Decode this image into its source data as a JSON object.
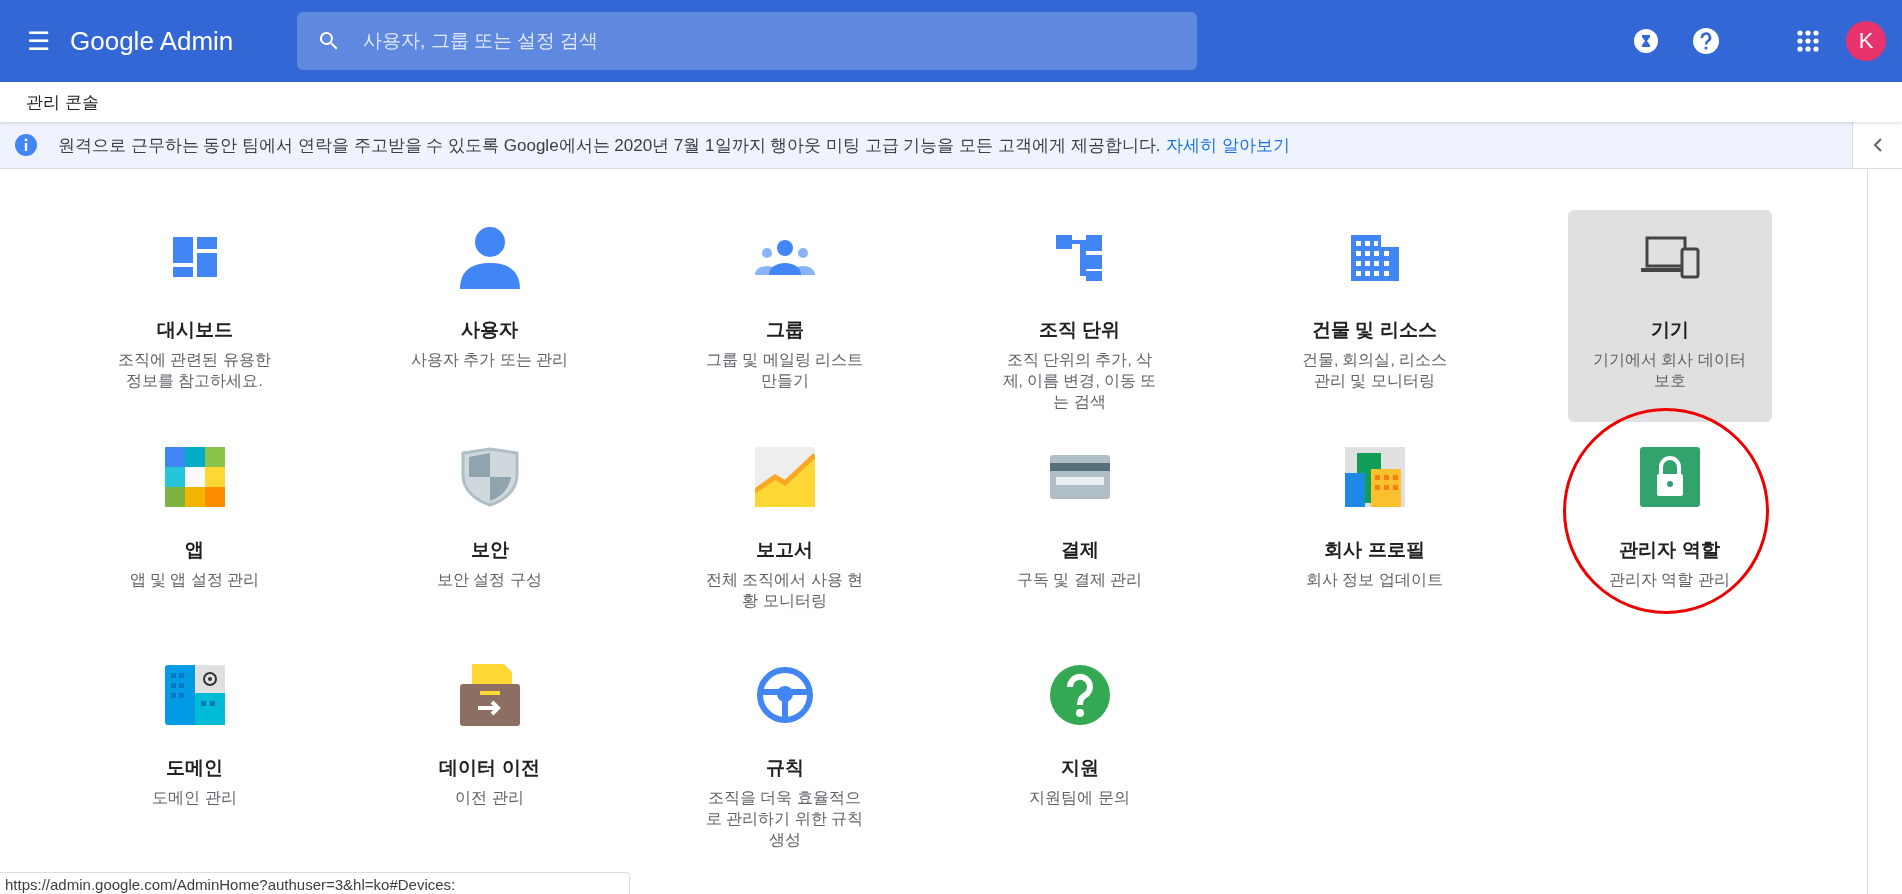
{
  "header": {
    "menu": "☰",
    "logo": "Google Admin",
    "search": {
      "placeholder": "사용자, 그룹 또는 설정 검색"
    },
    "avatar": "K"
  },
  "breadcrumb": "관리 콘솔",
  "banner": {
    "text": "원격으로 근무하는 동안 팀에서 연락을 주고받을 수 있도록 Google에서는 2020년 7월 1일까지 행아웃 미팅 고급 기능을 모든 고객에게 제공합니다.",
    "link": "자세히 알아보기"
  },
  "cards": [
    {
      "title": "대시보드",
      "description": "조직에 관련된 유용한 정보를 참고하세요.",
      "selected": false,
      "circled": false
    },
    {
      "title": "사용자",
      "description": "사용자 추가 또는 관리",
      "selected": false,
      "circled": false
    },
    {
      "title": "그룹",
      "description": "그룹 및 메일링 리스트 만들기",
      "selected": false,
      "circled": false
    },
    {
      "title": "조직 단위",
      "description": "조직 단위의 추가, 삭제, 이름 변경, 이동 또는 검색",
      "selected": false,
      "circled": false
    },
    {
      "title": "건물 및 리소스",
      "description": "건물, 회의실, 리소스 관리 및 모니터링",
      "selected": false,
      "circled": false
    },
    {
      "title": "기기",
      "description": "기기에서 회사 데이터 보호",
      "selected": true,
      "circled": false
    },
    {
      "title": "앱",
      "description": "앱 및 앱 설정 관리",
      "selected": false,
      "circled": false
    },
    {
      "title": "보안",
      "description": "보안 설정 구성",
      "selected": false,
      "circled": false
    },
    {
      "title": "보고서",
      "description": "전체 조직에서 사용 현황 모니터링",
      "selected": false,
      "circled": false
    },
    {
      "title": "결제",
      "description": "구독 및 결제 관리",
      "selected": false,
      "circled": false
    },
    {
      "title": "회사 프로필",
      "description": "회사 정보 업데이트",
      "selected": false,
      "circled": false
    },
    {
      "title": "관리자 역할",
      "description": "관리자 역할 관리",
      "selected": false,
      "circled": true
    },
    {
      "title": "도메인",
      "description": "도메인 관리",
      "selected": false,
      "circled": false
    },
    {
      "title": "데이터 이전",
      "description": "이전 관리",
      "selected": false,
      "circled": false
    },
    {
      "title": "규칙",
      "description": "조직을 더욱 효율적으로 관리하기 위한 규칙 생성",
      "selected": false,
      "circled": false
    },
    {
      "title": "지원",
      "description": "지원팀에 문의",
      "selected": false,
      "circled": false
    }
  ],
  "status_bar": "https://admin.google.com/AdminHome?authuser=3&hl=ko#Devices:"
}
